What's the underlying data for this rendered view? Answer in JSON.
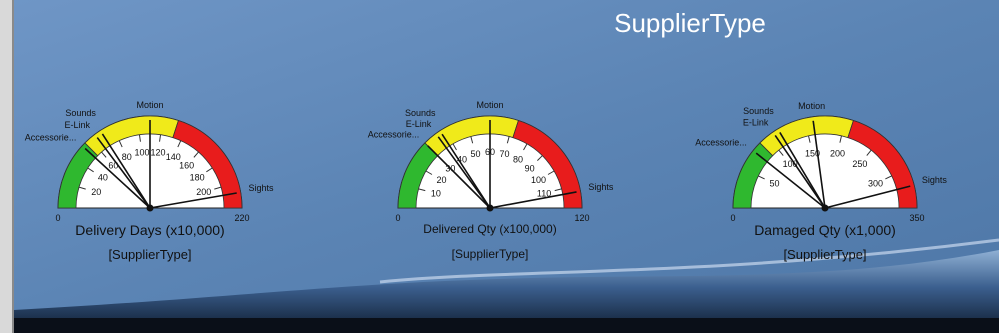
{
  "header": {
    "title": "SupplierType"
  },
  "gauges": [
    {
      "label_line1": "Delivery Days (x10,000)",
      "label_line2": "[SupplierType]",
      "min": 0,
      "max": 220,
      "max_label": "220",
      "min_label": "0",
      "tick_labels": [
        "20",
        "40",
        "60",
        "80",
        "100",
        "120",
        "140",
        "160",
        "180",
        "200"
      ],
      "needles": [
        {
          "name": "Accessorie...",
          "value": 52
        },
        {
          "name": "E-Link",
          "value": 65
        },
        {
          "name": "Sounds",
          "value": 70
        },
        {
          "name": "Motion",
          "value": 110
        },
        {
          "name": "Sights",
          "value": 208
        }
      ]
    },
    {
      "label_line1": "Delivered Qty (x100,000)",
      "label_line2": "[SupplierType]",
      "min": 0,
      "max": 120,
      "max_label": "120",
      "min_label": "0",
      "tick_labels": [
        "10",
        "20",
        "30",
        "40",
        "50",
        "60",
        "70",
        "80",
        "90",
        "100",
        "110"
      ],
      "needles": [
        {
          "name": "Accessorie...",
          "value": 30
        },
        {
          "name": "E-Link",
          "value": 36
        },
        {
          "name": "Sounds",
          "value": 38
        },
        {
          "name": "Motion",
          "value": 60
        },
        {
          "name": "Sights",
          "value": 113
        }
      ]
    },
    {
      "label_line1": "Damaged Qty (x1,000)",
      "label_line2": "[SupplierType]",
      "min": 0,
      "max": 350,
      "max_label": "350",
      "min_label": "0",
      "tick_labels": [
        "50",
        "100",
        "150",
        "200",
        "250",
        "300"
      ],
      "needles": [
        {
          "name": "Accessorie...",
          "value": 75
        },
        {
          "name": "E-Link",
          "value": 108
        },
        {
          "name": "Sounds",
          "value": 115
        },
        {
          "name": "Motion",
          "value": 160
        },
        {
          "name": "Sights",
          "value": 322
        }
      ]
    }
  ],
  "colors": {
    "background": "#5b84b4",
    "zone_green": "#2fb82f",
    "zone_yellow": "#f0ea1a",
    "zone_red": "#e81c1c",
    "needle": "#111111",
    "title": "#ffffff"
  }
}
